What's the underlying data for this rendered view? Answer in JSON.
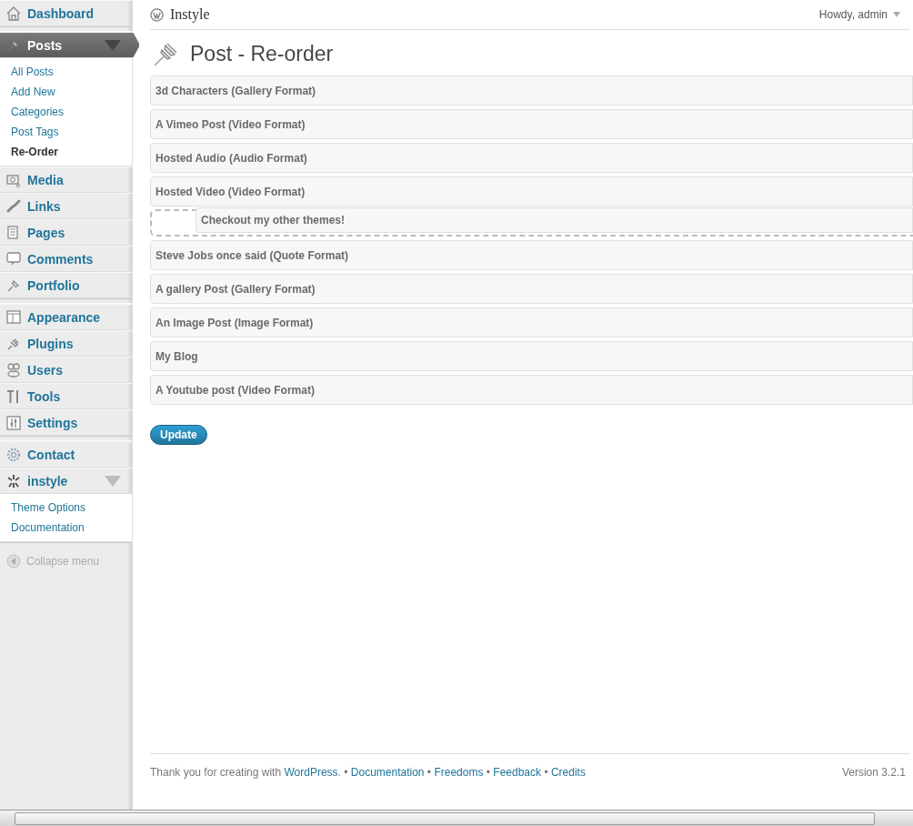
{
  "menu_groups": [
    [
      {
        "label": "Dashboard",
        "selected": false,
        "expanded": false
      }
    ],
    [
      {
        "label": "Posts",
        "selected": true,
        "expanded": true,
        "submenu": [
          {
            "label": "All Posts",
            "selected": false
          },
          {
            "label": "Add New",
            "selected": false
          },
          {
            "label": "Categories",
            "selected": false
          },
          {
            "label": "Post Tags",
            "selected": false
          },
          {
            "label": "Re-Order",
            "selected": true
          }
        ]
      },
      {
        "label": "Media",
        "selected": false,
        "expanded": false
      },
      {
        "label": "Links",
        "selected": false,
        "expanded": false
      },
      {
        "label": "Pages",
        "selected": false,
        "expanded": false
      },
      {
        "label": "Comments",
        "selected": false,
        "expanded": false
      },
      {
        "label": "Portfolio",
        "selected": false,
        "expanded": false
      }
    ],
    [
      {
        "label": "Appearance",
        "selected": false,
        "expanded": false
      },
      {
        "label": "Plugins",
        "selected": false,
        "expanded": false
      },
      {
        "label": "Users",
        "selected": false,
        "expanded": false
      },
      {
        "label": "Tools",
        "selected": false,
        "expanded": false
      },
      {
        "label": "Settings",
        "selected": false,
        "expanded": false
      }
    ],
    [
      {
        "label": "Contact",
        "selected": false,
        "expanded": false
      },
      {
        "label": "instyle",
        "selected": false,
        "expanded": true,
        "submenu": [
          {
            "label": "Theme Options",
            "selected": false
          },
          {
            "label": "Documentation",
            "selected": false
          }
        ]
      }
    ]
  ],
  "collapse_menu": "Collapse menu",
  "header": {
    "site_name": "Instyle",
    "greeting": "Howdy, admin"
  },
  "page_title": "Post - Re-order",
  "posts": [
    {
      "kind": "item",
      "label": "3d Characters (Gallery Format)"
    },
    {
      "kind": "item",
      "label": "A Vimeo Post (Video Format)"
    },
    {
      "kind": "item",
      "label": "Hosted Audio (Audio Format)"
    },
    {
      "kind": "item",
      "label": "Hosted Video (Video Format)"
    },
    {
      "kind": "placeholder",
      "label": "Checkout my other themes!"
    },
    {
      "kind": "item",
      "label": "Steve Jobs once said (Quote Format)"
    },
    {
      "kind": "item",
      "label": "A gallery Post (Gallery Format)"
    },
    {
      "kind": "item",
      "label": "An Image Post (Image Format)"
    },
    {
      "kind": "item",
      "label": "My Blog"
    },
    {
      "kind": "item",
      "label": "A Youtube post (Video Format)"
    }
  ],
  "update_button": "Update",
  "footer": {
    "text": "Thank you for creating with",
    "link": "WordPress",
    "end": ".",
    "separator": "•",
    "links": [
      "Documentation",
      "Freedoms",
      "Feedback",
      "Credits"
    ],
    "version": "Version 3.2.1"
  }
}
